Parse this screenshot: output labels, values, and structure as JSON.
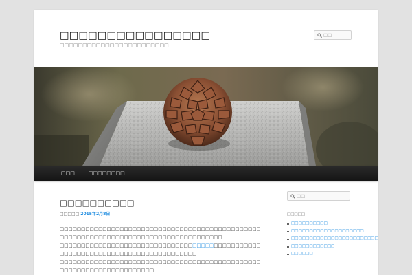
{
  "site": {
    "title": "□□□□□□□□□□□□□□□□",
    "description": "□□□□□□□□□□□□□□□□□□□□□□□□"
  },
  "header_search": {
    "placeholder": "□□",
    "icon": "search-icon"
  },
  "nav": {
    "items": [
      {
        "label": "□□□"
      },
      {
        "label": "□□□□□□□□"
      }
    ]
  },
  "post": {
    "title": "□□□□□□□□□□",
    "meta_prefix": "□□□□□",
    "date": "2015年2月8日",
    "paragraphs": [
      {
        "line1": "□□□□□□□□□□□□□□□□□□□□□□□□□□□□□□□□□□□□□□□□□□□□□□□□□□□□□□□",
        "line2": "□□□□□□□□□□□□□□□□□□□□□□□□□□□□□□□□□□□□□□"
      },
      {
        "line1_before": "□□□□□□□□□□□□□□□□□□□□□□□□□□□□□□□",
        "line1_link": "□□□□□",
        "line1_after": "□□□□□□□□□□□□□□□□□□□□□□",
        "line2": "□□□□□□□□□□□□□□□□□□□□□□□□□□□□□□□□"
      },
      {
        "line1": "□□□□□□□□□□□□□□□□□□□□□□□□□□□□□□□□□□□□□□□□□□□□□□□□□□□□□□□",
        "line2": "□□□□□□□□□□□□□□□□□□□□□□"
      }
    ]
  },
  "sidebar": {
    "search_placeholder": "□□",
    "widget_title": "□□□□□",
    "recent_posts": [
      {
        "label": "□□□□□□□□□□"
      },
      {
        "label": "□□□□□□□□□□□□□□□□□□□□"
      },
      {
        "label": "□□□□□□□□□□□□□□□□□□□□□□□□□□□□□□□□□□□□□□□□□□"
      },
      {
        "label": "□□□□□□□□□□□□"
      },
      {
        "label": "□□□□□□"
      }
    ]
  },
  "colors": {
    "page_background": "#e2e2e2",
    "content_background": "#ffffff",
    "nav_background": "#222222",
    "link": "#1b8be0",
    "text": "#373737"
  }
}
